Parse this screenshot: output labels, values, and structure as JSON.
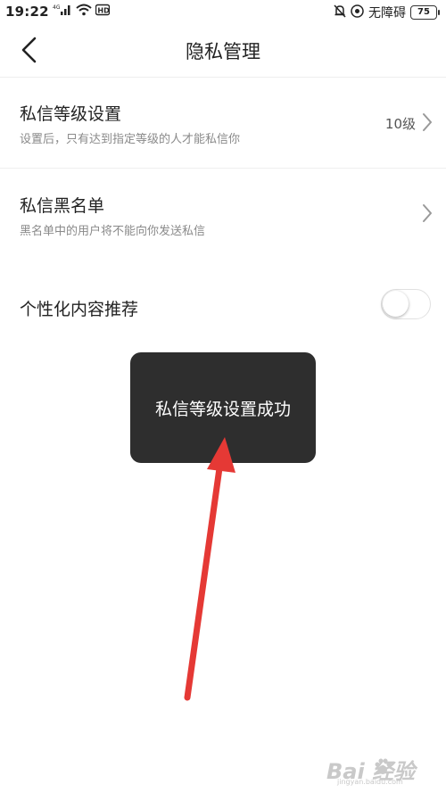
{
  "status_bar": {
    "time": "19:22",
    "network": "4G",
    "accessibility": "无障碍",
    "battery": "75"
  },
  "header": {
    "title": "隐私管理"
  },
  "settings": {
    "message_level": {
      "title": "私信等级设置",
      "subtitle": "设置后，只有达到指定等级的人才能私信你",
      "value": "10级"
    },
    "blacklist": {
      "title": "私信黑名单",
      "subtitle": "黑名单中的用户将不能向你发送私信"
    },
    "personalized": {
      "title": "个性化内容推荐",
      "enabled": false
    }
  },
  "toast": {
    "message": "私信等级设置成功"
  },
  "watermark": {
    "brand": "Bai  经验",
    "url": "jingyan.baidu.com"
  },
  "colors": {
    "toast_bg": "#2e2e2e",
    "arrow": "#e53935",
    "subtitle": "#8a8a8a"
  }
}
